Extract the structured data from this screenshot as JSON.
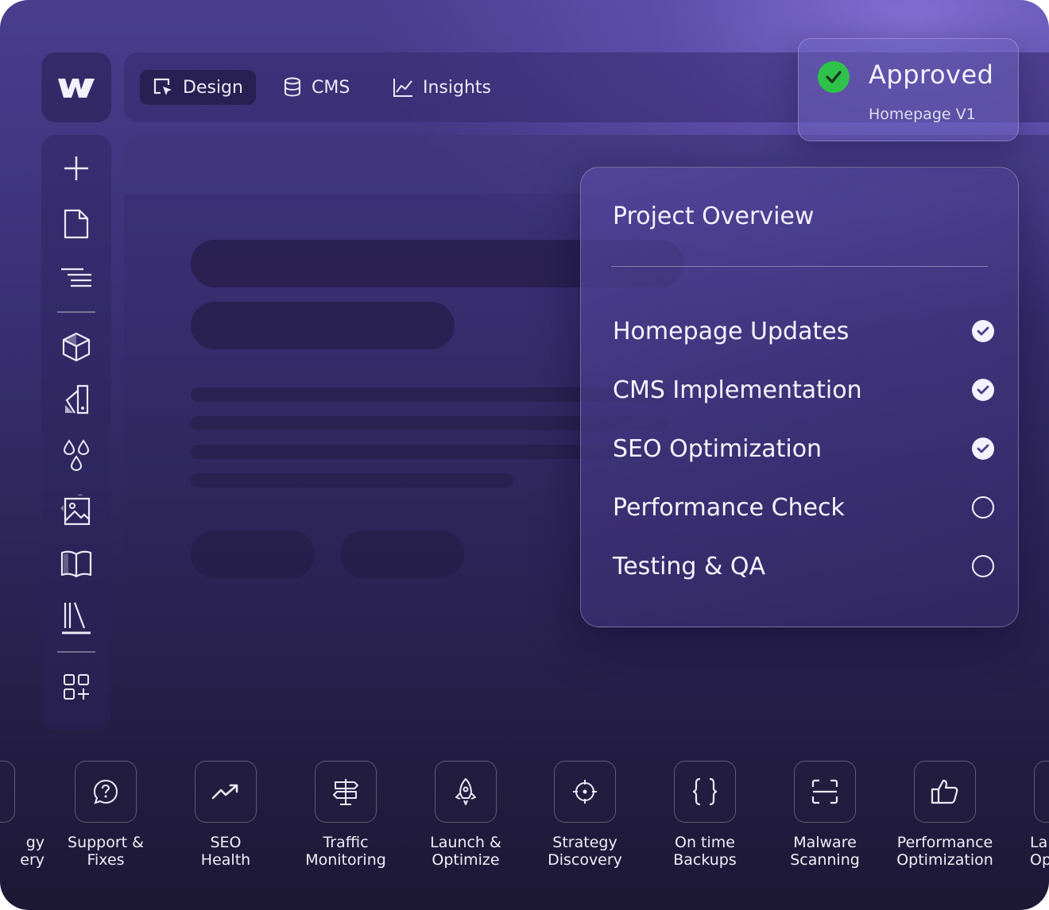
{
  "topbar": {
    "tabs": [
      {
        "label": "Design",
        "icon": "design-cursor-icon",
        "active": true
      },
      {
        "label": "CMS",
        "icon": "database-icon",
        "active": false
      },
      {
        "label": "Insights",
        "icon": "chart-line-icon",
        "active": false
      }
    ]
  },
  "sidebar": {
    "icons": [
      "plus-icon",
      "page-icon",
      "navigator-icon",
      "components-cube-icon",
      "style-swatch-icon",
      "variables-drops-icon",
      "assets-image-icon",
      "book-icon",
      "library-icon",
      "apps-icon"
    ]
  },
  "approved": {
    "title": "Approved",
    "subtitle": "Homepage V1",
    "color": "#2ec24a"
  },
  "overview": {
    "heading": "Project Overview",
    "tasks": [
      {
        "label": "Homepage Updates",
        "done": true
      },
      {
        "label": "CMS Implementation",
        "done": true
      },
      {
        "label": "SEO Optimization",
        "done": true
      },
      {
        "label": "Performance Check",
        "done": false
      },
      {
        "label": "Testing & QA",
        "done": false
      }
    ]
  },
  "services": [
    {
      "name": "gy\nery",
      "icon": "partial-icon"
    },
    {
      "name": "Support &\nFixes",
      "icon": "help-bubble-icon"
    },
    {
      "name": "SEO\nHealth",
      "icon": "trend-up-icon"
    },
    {
      "name": "Traffic\nMonitoring",
      "icon": "signpost-icon"
    },
    {
      "name": "Launch &\nOptimize",
      "icon": "rocket-icon"
    },
    {
      "name": "Strategy\nDiscovery",
      "icon": "crosshair-icon"
    },
    {
      "name": "On time\nBackups",
      "icon": "braces-icon"
    },
    {
      "name": "Malware\nScanning",
      "icon": "scan-icon"
    },
    {
      "name": "Performance\nOptimization",
      "icon": "thumbs-up-icon"
    },
    {
      "name": "La\nOp",
      "icon": "partial-icon"
    }
  ]
}
